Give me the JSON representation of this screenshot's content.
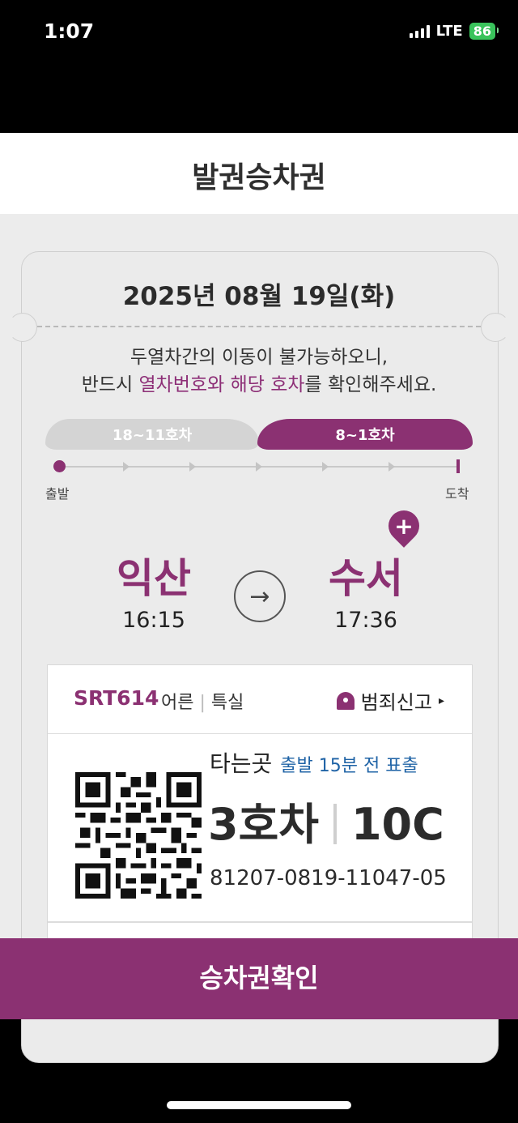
{
  "status_bar": {
    "time": "1:07",
    "network": "LTE",
    "battery": "86"
  },
  "header": {
    "title": "발권승차권"
  },
  "ticket": {
    "date": "2025년 08월 19일(화)",
    "notice": {
      "line1": "두열차간의 이동이 불가능하오니,",
      "line2_prefix": "반드시 ",
      "line2_highlight": "열차번호와 해당 호차",
      "line2_suffix": "를 확인해주세요."
    },
    "car_groups": [
      "18~11호차",
      "8~1호차"
    ],
    "track": {
      "departure_label": "출발",
      "arrival_label": "도착"
    },
    "departure": {
      "station": "익산",
      "time": "16:15"
    },
    "arrival": {
      "station": "수서",
      "time": "17:36"
    },
    "go_icon": "→",
    "pin_icon": "+",
    "train_info": {
      "train_no": "SRT614",
      "passenger": "어른",
      "class": "특실",
      "report_label": "범죄신고",
      "report_arrow": "▸"
    },
    "boarding": {
      "label": "타는곳",
      "note": "출발 15분 전 표출",
      "car": "3호차",
      "seat": "10C",
      "ticket_number": "81207-0819-11047-05"
    }
  },
  "cta": {
    "label": "승차권확인"
  },
  "colors": {
    "brand": "#8b3172",
    "info_blue": "#1f63a6",
    "battery": "#39c35b"
  }
}
